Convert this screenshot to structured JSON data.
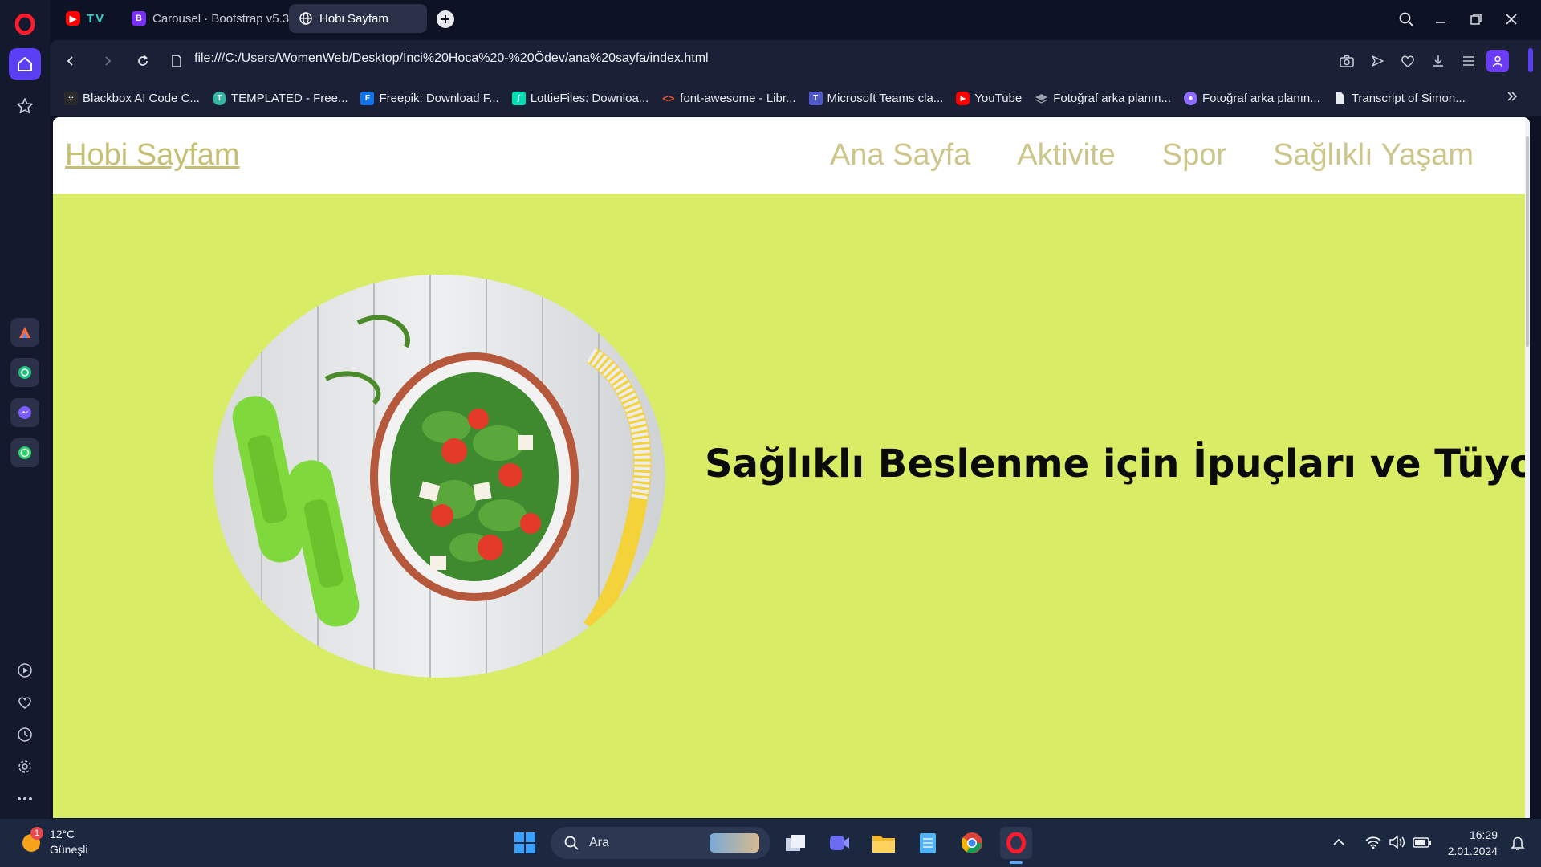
{
  "tabs": [
    {
      "label": "TV",
      "icon": "youtube-tv-icon"
    },
    {
      "label": "Carousel · Bootstrap v5.3",
      "icon": "bootstrap-icon"
    },
    {
      "label": "Hobi Sayfam",
      "icon": "globe-icon",
      "active": true
    }
  ],
  "address": {
    "url": "file:///C:/Users/WomenWeb/Desktop/İnci%20Hoca%20-%20Ödev/ana%20sayfa/index.html"
  },
  "bookmarks": [
    {
      "label": "Blackbox AI Code C...",
      "icon": "blackbox-icon",
      "color": "#2a2a2a"
    },
    {
      "label": "TEMPLATED - Free...",
      "icon": "templated-icon",
      "color": "#37b6a4"
    },
    {
      "label": "Freepik: Download F...",
      "icon": "freepik-icon",
      "color": "#1273eb"
    },
    {
      "label": "LottieFiles: Downloa...",
      "icon": "lottiefiles-icon",
      "color": "#00ddb3"
    },
    {
      "label": "font-awesome - Libr...",
      "icon": "code-icon",
      "color": "#e8572d"
    },
    {
      "label": "Microsoft Teams cla...",
      "icon": "teams-icon",
      "color": "#5059c9"
    },
    {
      "label": "YouTube",
      "icon": "youtube-icon",
      "color": "#ff0000"
    },
    {
      "label": "Fotoğraf arka planın...",
      "icon": "layers-icon",
      "color": "#9aa0ad"
    },
    {
      "label": "Fotoğraf arka planın...",
      "icon": "photoroom-icon",
      "color": "#8e6bff"
    },
    {
      "label": "Transcript of Simon...",
      "icon": "document-icon",
      "color": "#e8eaf0"
    }
  ],
  "site": {
    "brand": "Hobi Sayfam",
    "menu": [
      "Ana Sayfa",
      "Aktivite",
      "Spor",
      "Sağlıklı Yaşam"
    ],
    "hero_title": "Sağlıklı Beslenme için İpuçları ve Tüyoları...",
    "hero_bg": "#d8ec66",
    "link_color": "#c5bf74"
  },
  "taskbar": {
    "weather_temp": "12°C",
    "weather_desc": "Güneşli",
    "weather_badge": "1",
    "search_placeholder": "Ara",
    "time": "16:29",
    "date": "2.01.2024"
  },
  "colors": {
    "accent": "#5b3ff5",
    "opera_red": "#ff1b2d"
  }
}
